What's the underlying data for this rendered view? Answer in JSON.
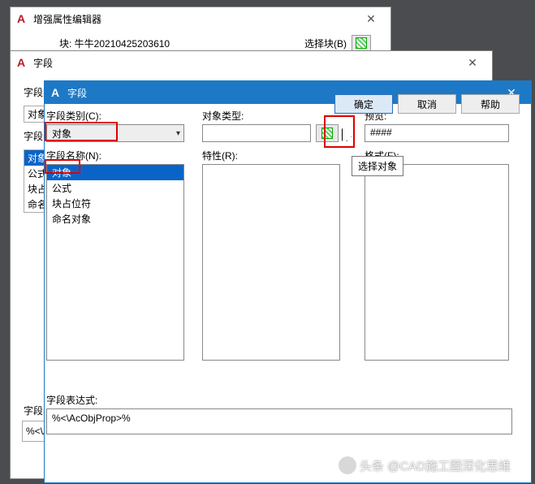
{
  "w1": {
    "title": "增强属性编辑器",
    "block_label": "块: 牛牛20210425203610",
    "select_label": "选择块(B)"
  },
  "w2": {
    "title": "字段",
    "cat_label": "字段类别:",
    "cat_value": "对象",
    "names": {
      "i0": "对象",
      "i1": "公式",
      "i2": "块占位符",
      "i3": "命名对象"
    },
    "expr_label": "字段表达式:",
    "expr_value": "%<\\AcObjProp>%"
  },
  "w3": {
    "title": "字段",
    "cat_label": "字段类别(C):",
    "cat_value": "对象",
    "name_label": "字段名称(N):",
    "names": {
      "i0": "对象",
      "i1": "公式",
      "i2": "块占位符",
      "i3": "命名对象"
    },
    "objtype_label": "对象类型:",
    "props_label": "特性(R):",
    "preview_label": "预览:",
    "preview_value": "####",
    "format_label": "格式(F):",
    "tooltip": "选择对象",
    "expr_label": "字段表达式:",
    "expr_value": "%<\\AcObjProp>%",
    "ok": "确定",
    "cancel": "取消",
    "help": "帮助"
  },
  "watermark": "头条 @CAD施工图深化思维"
}
